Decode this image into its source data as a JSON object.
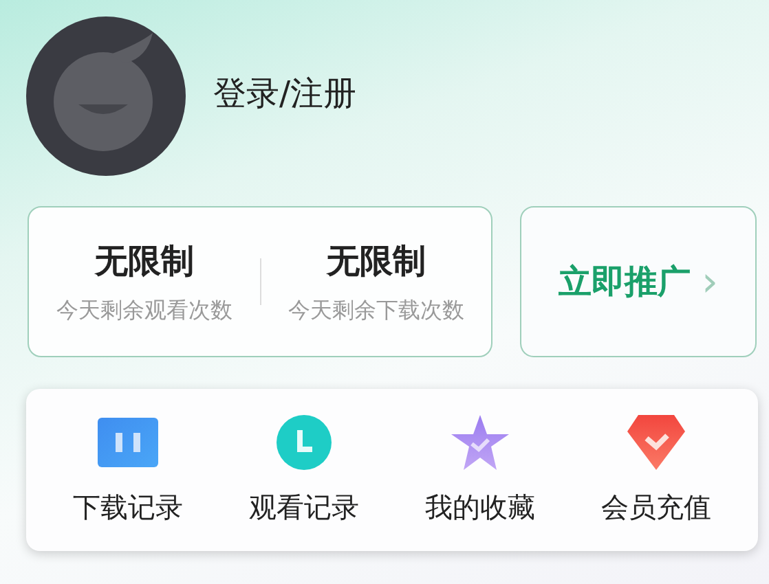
{
  "profile": {
    "login_label": "登录/注册"
  },
  "stats": [
    {
      "value": "无限制",
      "caption": "今天剩余观看次数"
    },
    {
      "value": "无限制",
      "caption": "今天剩余下载次数"
    }
  ],
  "promote": {
    "label": "立即推广",
    "arrow": "›"
  },
  "menu": [
    {
      "kind": "download",
      "label": "下载记录"
    },
    {
      "kind": "history",
      "label": "观看记录"
    },
    {
      "kind": "favorites",
      "label": "我的收藏"
    },
    {
      "kind": "vip",
      "label": "会员充值"
    }
  ]
}
